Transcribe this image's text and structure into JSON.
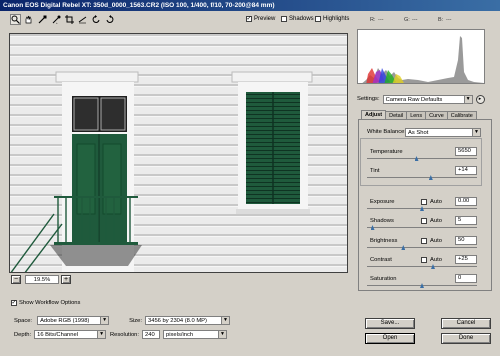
{
  "window": {
    "title": "Canon EOS Digital Rebel XT:  350d_0000_1563.CR2  (ISO 100, 1/400, f/10, 70-200@84 mm)"
  },
  "toolbar": {
    "tools": [
      "zoom-icon",
      "hand-icon",
      "white-balance-icon",
      "color-sampler-icon",
      "crop-icon",
      "straighten-icon",
      "rotate-left-icon",
      "rotate-right-icon"
    ],
    "preview_label": "Preview",
    "shadows_label": "Shadows",
    "highlights_label": "Highlights",
    "preview_checked": true,
    "r_label": "R:",
    "g_label": "G:",
    "b_label": "B:",
    "r_val": "---",
    "g_val": "---",
    "b_val": "---"
  },
  "zoom": {
    "minus": "−",
    "value": "19.5%",
    "plus": "+"
  },
  "settings": {
    "label": "Settings:",
    "value": "Camera Raw Defaults"
  },
  "tabs": [
    "Adjust",
    "Detail",
    "Lens",
    "Curve",
    "Calibrate"
  ],
  "adjust": {
    "white_balance_label": "White Balance:",
    "white_balance_value": "As Shot",
    "temperature": {
      "label": "Temperature",
      "value": "5650",
      "level": 0.45
    },
    "tint": {
      "label": "Tint",
      "value": "+14",
      "level": 0.58
    },
    "auto_label": "Auto",
    "exposure": {
      "label": "Exposure",
      "value": "0.00",
      "level": 0.5
    },
    "shadows": {
      "label": "Shadows",
      "value": "5",
      "level": 0.05
    },
    "brightness": {
      "label": "Brightness",
      "value": "50",
      "level": 0.33
    },
    "contrast": {
      "label": "Contrast",
      "value": "+25",
      "level": 0.6
    },
    "saturation": {
      "label": "Saturation",
      "value": "0",
      "level": 0.5
    }
  },
  "workflow": {
    "show_label": "Show Workflow Options",
    "space_label": "Space:",
    "space_value": "Adobe RGB (1998)",
    "size_label": "Size:",
    "size_value": "3456 by 2304  (8.0 MP)",
    "depth_label": "Depth:",
    "depth_value": "16 Bits/Channel",
    "resolution_label": "Resolution:",
    "resolution_value": "240",
    "resolution_unit": "pixels/inch"
  },
  "buttons": {
    "save": "Save...",
    "cancel": "Cancel",
    "open": "Open",
    "done": "Done"
  },
  "colors": {
    "accent": "#3a6ea5",
    "door_green": "#1f5a3c",
    "title_bar": "#0a246a"
  }
}
